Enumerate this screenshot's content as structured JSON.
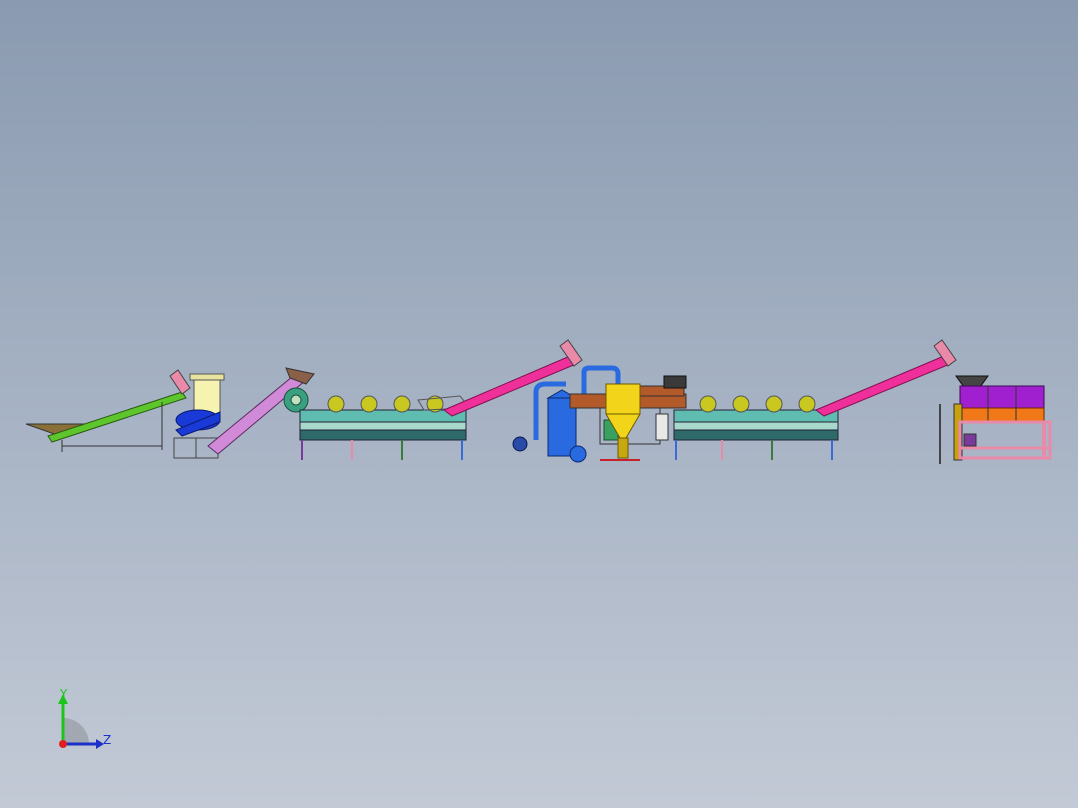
{
  "viewport": {
    "background_top": "#8a9ab0",
    "background_bottom": "#c3cad6"
  },
  "triad": {
    "y_label": "Y",
    "z_label": "Z",
    "y_color": "#1cc41c",
    "z_color": "#1a30c8",
    "origin_color": "#e02020"
  },
  "model": {
    "description_icon": "plastic-washing-line-assembly",
    "colors": {
      "green_conveyor": "#5cc62c",
      "crusher_blue": "#1a3ad8",
      "crusher_cream": "#f6f2b0",
      "violet_conveyor": "#d08ad8",
      "tank_teal": "#5fbcb0",
      "tank_dark": "#2e6a6a",
      "pink_conveyor": "#f0309a",
      "dryer_blue": "#2a6ae0",
      "cyclone_yellow": "#f2d41a",
      "brown_body": "#b25a2a",
      "purple_hopper": "#a020d0",
      "orange_hopper": "#f07818",
      "pink_frame": "#e88aa8",
      "roller_yellow": "#c8c820"
    }
  }
}
